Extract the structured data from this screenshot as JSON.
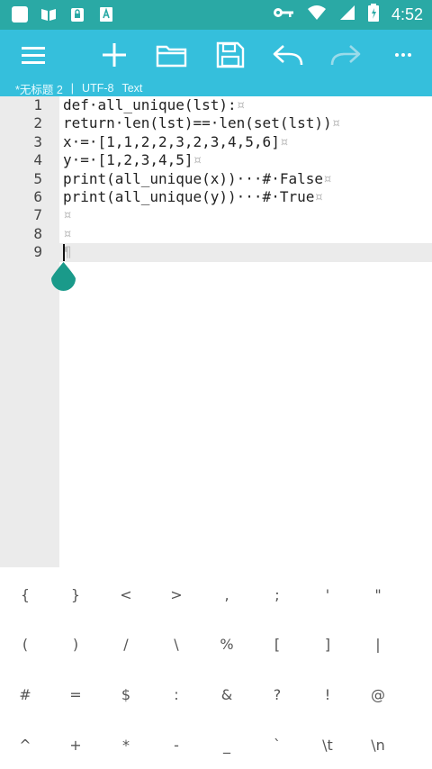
{
  "status_bar": {
    "time": "4:52",
    "left_icons": [
      "app-icon",
      "book-icon",
      "lock-app-icon",
      "font-app-icon"
    ],
    "right_icons": [
      "key-icon",
      "wifi-icon",
      "signal-icon",
      "battery-icon"
    ]
  },
  "toolbar": {
    "buttons": [
      "menu-icon",
      "add-icon",
      "open-folder-icon",
      "save-icon",
      "undo-icon",
      "redo-icon",
      "more-icon"
    ]
  },
  "file_info": {
    "name": "*无标题 2",
    "sep1": "|",
    "encoding": "UTF-8",
    "type": "Text"
  },
  "editor": {
    "lines": [
      {
        "num": "1",
        "text": "def·all_unique(lst):",
        "eol": "¤"
      },
      {
        "num": "2",
        "text": "return·len(lst)==·len(set(lst))",
        "eol": "¤"
      },
      {
        "num": "3",
        "text": "x·=·[1,1,2,2,3,2,3,4,5,6]",
        "eol": "¤"
      },
      {
        "num": "4",
        "text": "y·=·[1,2,3,4,5]",
        "eol": "¤"
      },
      {
        "num": "5",
        "text": "print(all_unique(x))···#·False",
        "eol": "¤"
      },
      {
        "num": "6",
        "text": "print(all_unique(y))···#·True",
        "eol": "¤"
      },
      {
        "num": "7",
        "text": "",
        "eol": "¤"
      },
      {
        "num": "8",
        "text": "",
        "eol": "¤"
      },
      {
        "num": "9",
        "text": "",
        "eol": "¶"
      }
    ],
    "current_line": 9
  },
  "symbol_keys": [
    [
      "{",
      "}",
      "<",
      ">",
      ",",
      ";",
      "'",
      "\""
    ],
    [
      "(",
      ")",
      "/",
      "\\",
      "%",
      "[",
      "]",
      "|"
    ],
    [
      "#",
      "=",
      "$",
      ":",
      "&",
      "?",
      "!",
      "@"
    ],
    [
      "^",
      "+",
      "*",
      "-",
      "_",
      "`",
      "\\t",
      "\\n"
    ]
  ],
  "colors": {
    "status_bar": "#2aa9a5",
    "toolbar": "#35bfdc",
    "gutter": "#ebebeb",
    "cursor_handle": "#1a9a8a"
  }
}
